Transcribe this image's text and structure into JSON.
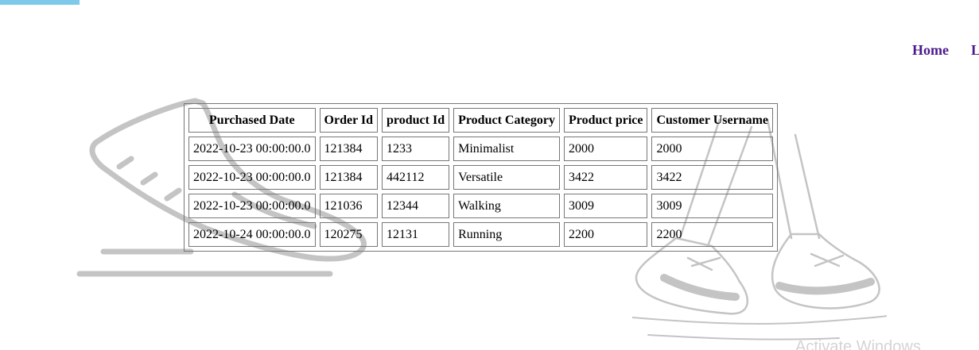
{
  "nav": {
    "items": [
      "Home",
      "L"
    ]
  },
  "orders": {
    "columns": [
      "Purchased Date",
      "Order Id",
      "product Id",
      "Product Category",
      "Product price",
      "Customer Username"
    ],
    "rows": [
      [
        "2022-10-23 00:00:00.0",
        "121384",
        "1233",
        "Minimalist",
        "2000",
        "2000"
      ],
      [
        "2022-10-23 00:00:00.0",
        "121384",
        "442112",
        "Versatile",
        "3422",
        "3422"
      ],
      [
        "2022-10-23 00:00:00.0",
        "121036",
        "12344",
        "Walking",
        "3009",
        "3009"
      ],
      [
        "2022-10-24 00:00:00.0",
        "120275",
        "12131",
        "Running",
        "2200",
        "2200"
      ]
    ]
  },
  "watermark": "Activate Windows",
  "colors": {
    "nav_link": "#4a1a8c",
    "top_accent": "#7ec8ea",
    "illustration": "#c4c4c4"
  }
}
